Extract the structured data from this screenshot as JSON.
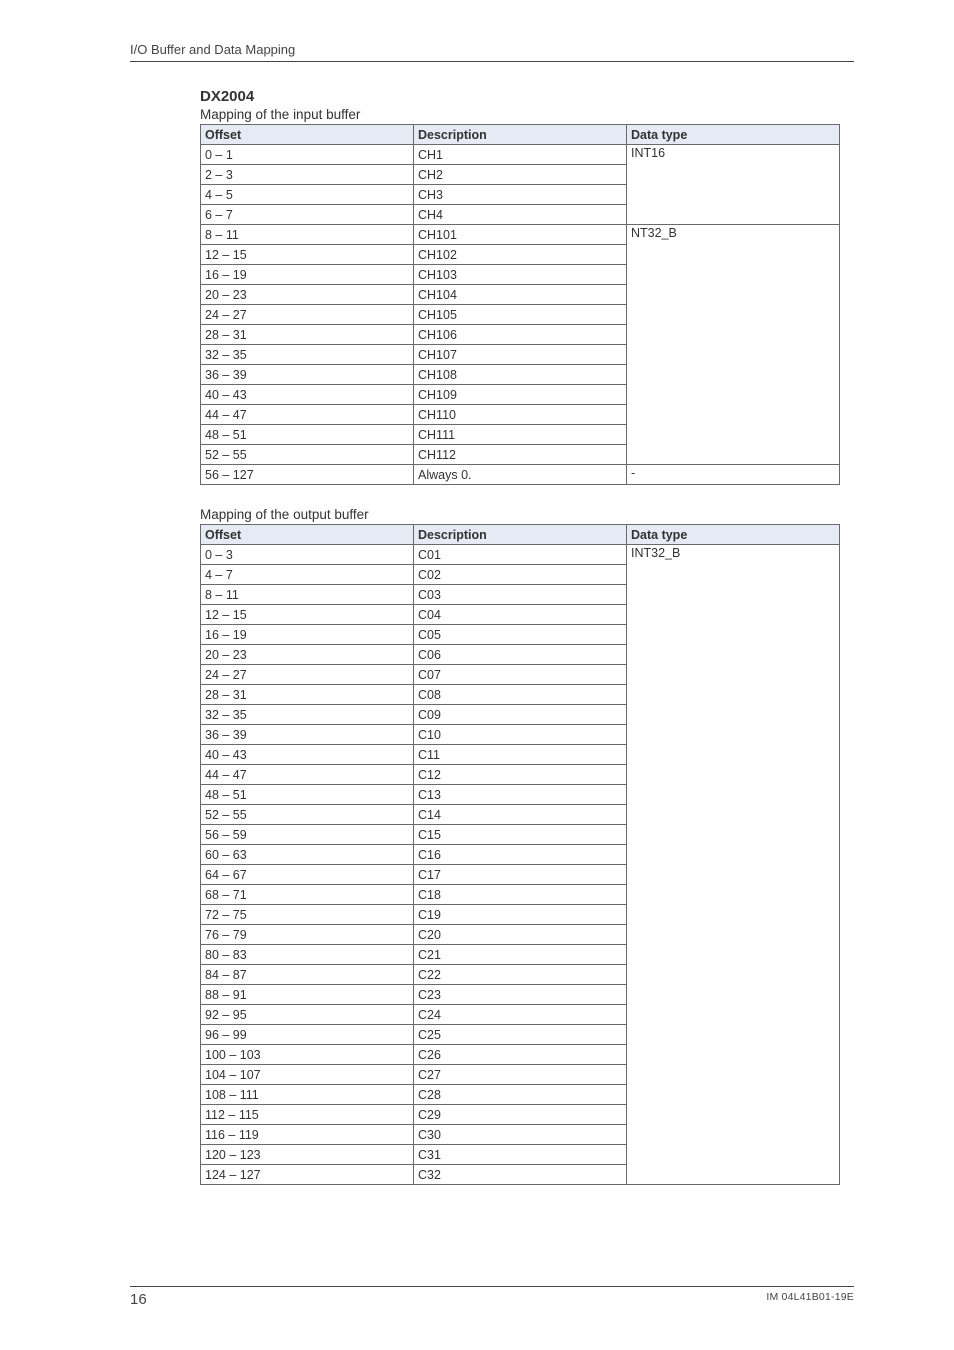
{
  "section_header": "I/O Buffer and Data Mapping",
  "device_heading": "DX2004",
  "table1": {
    "caption": "Mapping of the input buffer",
    "headers": {
      "offset": "Offset",
      "description": "Description",
      "datatype": "Data type"
    },
    "groups": [
      {
        "datatype": "INT16",
        "rows": [
          {
            "offset": "0 – 1",
            "desc": "CH1"
          },
          {
            "offset": "2 – 3",
            "desc": "CH2"
          },
          {
            "offset": "4 – 5",
            "desc": "CH3"
          },
          {
            "offset": "6 – 7",
            "desc": "CH4"
          }
        ]
      },
      {
        "datatype": "NT32_B",
        "rows": [
          {
            "offset": "8 – 11",
            "desc": "CH101"
          },
          {
            "offset": "12 – 15",
            "desc": "CH102"
          },
          {
            "offset": "16 – 19",
            "desc": "CH103"
          },
          {
            "offset": "20 – 23",
            "desc": "CH104"
          },
          {
            "offset": "24 – 27",
            "desc": "CH105"
          },
          {
            "offset": "28 – 31",
            "desc": "CH106"
          },
          {
            "offset": "32 – 35",
            "desc": "CH107"
          },
          {
            "offset": "36 – 39",
            "desc": "CH108"
          },
          {
            "offset": "40 – 43",
            "desc": "CH109"
          },
          {
            "offset": "44 – 47",
            "desc": "CH110"
          },
          {
            "offset": "48 – 51",
            "desc": "CH111"
          },
          {
            "offset": "52 – 55",
            "desc": "CH112"
          }
        ]
      },
      {
        "datatype": "-",
        "rows": [
          {
            "offset": "56 – 127",
            "desc": "Always 0."
          }
        ]
      }
    ]
  },
  "table2": {
    "caption": "Mapping of the output buffer",
    "headers": {
      "offset": "Offset",
      "description": "Description",
      "datatype": "Data type"
    },
    "groups": [
      {
        "datatype": "INT32_B",
        "rows": [
          {
            "offset": "0 – 3",
            "desc": "C01"
          },
          {
            "offset": "4 – 7",
            "desc": "C02"
          },
          {
            "offset": "8 – 11",
            "desc": "C03"
          },
          {
            "offset": "12 – 15",
            "desc": "C04"
          },
          {
            "offset": "16 – 19",
            "desc": "C05"
          },
          {
            "offset": "20 – 23",
            "desc": "C06"
          },
          {
            "offset": "24 – 27",
            "desc": "C07"
          },
          {
            "offset": "28 – 31",
            "desc": "C08"
          },
          {
            "offset": "32 – 35",
            "desc": "C09"
          },
          {
            "offset": "36 – 39",
            "desc": "C10"
          },
          {
            "offset": "40 – 43",
            "desc": "C11"
          },
          {
            "offset": "44 – 47",
            "desc": "C12"
          },
          {
            "offset": "48 – 51",
            "desc": "C13"
          },
          {
            "offset": "52 – 55",
            "desc": "C14"
          },
          {
            "offset": "56 – 59",
            "desc": "C15"
          },
          {
            "offset": "60 – 63",
            "desc": "C16"
          },
          {
            "offset": "64 – 67",
            "desc": "C17"
          },
          {
            "offset": "68 – 71",
            "desc": "C18"
          },
          {
            "offset": "72 – 75",
            "desc": "C19"
          },
          {
            "offset": "76 – 79",
            "desc": "C20"
          },
          {
            "offset": "80 – 83",
            "desc": "C21"
          },
          {
            "offset": "84 – 87",
            "desc": "C22"
          },
          {
            "offset": "88 – 91",
            "desc": "C23"
          },
          {
            "offset": "92 – 95",
            "desc": "C24"
          },
          {
            "offset": "96 – 99",
            "desc": "C25"
          },
          {
            "offset": "100 – 103",
            "desc": "C26"
          },
          {
            "offset": "104 – 107",
            "desc": "C27"
          },
          {
            "offset": "108 – 111",
            "desc": "C28"
          },
          {
            "offset": "112 – 115",
            "desc": "C29"
          },
          {
            "offset": "116 – 119",
            "desc": "C30"
          },
          {
            "offset": "120 – 123",
            "desc": "C31"
          },
          {
            "offset": "124 – 127",
            "desc": "C32"
          }
        ]
      }
    ]
  },
  "footer": {
    "page_number": "16",
    "doc_code": "IM 04L41B01-19E"
  }
}
